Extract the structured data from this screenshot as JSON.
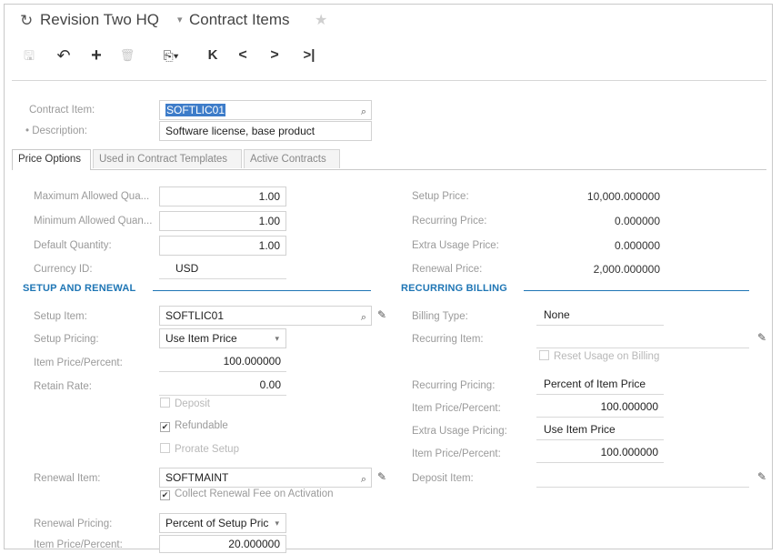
{
  "header": {
    "company": "Revision Two HQ",
    "screen": "Contract Items",
    "caret": "▾",
    "star": "★",
    "refresh": "↻"
  },
  "toolbar": {
    "save": "🖫",
    "undo": "↶",
    "add": "+",
    "delete": "🗑",
    "copy": "⎘▾",
    "first": "K",
    "prev": "<",
    "next": ">",
    "last": ">|"
  },
  "summary": {
    "contract_item_label": "Contract Item:",
    "contract_item_value": "SOFTLIC01",
    "description_label": "• Description:",
    "description_value": "Software license, base product"
  },
  "tabs": [
    "Price Options",
    "Used in Contract Templates",
    "Active Contracts"
  ],
  "price_options": {
    "max_qty_label": "Maximum Allowed Qua...",
    "max_qty_value": "1.00",
    "min_qty_label": "Minimum Allowed Quan...",
    "min_qty_value": "1.00",
    "default_qty_label": "Default Quantity:",
    "default_qty_value": "1.00",
    "currency_label": "Currency ID:",
    "currency_value": "USD",
    "setup_price_label": "Setup Price:",
    "setup_price_value": "10,000.000000",
    "recurring_price_label": "Recurring Price:",
    "recurring_price_value": "0.000000",
    "extra_usage_price_label": "Extra Usage Price:",
    "extra_usage_price_value": "0.000000",
    "renewal_price_label": "Renewal Price:",
    "renewal_price_value": "2,000.000000"
  },
  "setup_renewal": {
    "title": "SETUP AND RENEWAL",
    "setup_item_label": "Setup Item:",
    "setup_item_value": "SOFTLIC01",
    "setup_pricing_label": "Setup Pricing:",
    "setup_pricing_value": "Use Item Price",
    "item_price_pct_label": "Item Price/Percent:",
    "item_price_pct_value": "100.000000",
    "retain_rate_label": "Retain Rate:",
    "retain_rate_value": "0.00",
    "deposit_label": "Deposit",
    "refundable_label": "Refundable",
    "prorate_label": "Prorate Setup",
    "renewal_item_label": "Renewal Item:",
    "renewal_item_value": "SOFTMAINT",
    "collect_label": "Collect Renewal Fee on Activation",
    "renewal_pricing_label": "Renewal Pricing:",
    "renewal_pricing_value": "Percent of Setup Pric",
    "renewal_pct_label": "Item Price/Percent:",
    "renewal_pct_value": "20.000000"
  },
  "recurring": {
    "title": "RECURRING BILLING",
    "billing_type_label": "Billing Type:",
    "billing_type_value": "None",
    "recurring_item_label": "Recurring Item:",
    "recurring_item_value": "",
    "reset_usage_label": "Reset Usage on Billing",
    "recurring_pricing_label": "Recurring Pricing:",
    "recurring_pricing_value": "Percent of Item Price",
    "rec_pct_label": "Item Price/Percent:",
    "rec_pct_value": "100.000000",
    "extra_usage_pricing_label": "Extra Usage Pricing:",
    "extra_usage_pricing_value": "Use Item Price",
    "extra_pct_label": "Item Price/Percent:",
    "extra_pct_value": "100.000000",
    "deposit_item_label": "Deposit Item:",
    "deposit_item_value": ""
  },
  "icons": {
    "search": "⌕",
    "pencil": "✎",
    "check": "✔",
    "drop": "▾"
  }
}
